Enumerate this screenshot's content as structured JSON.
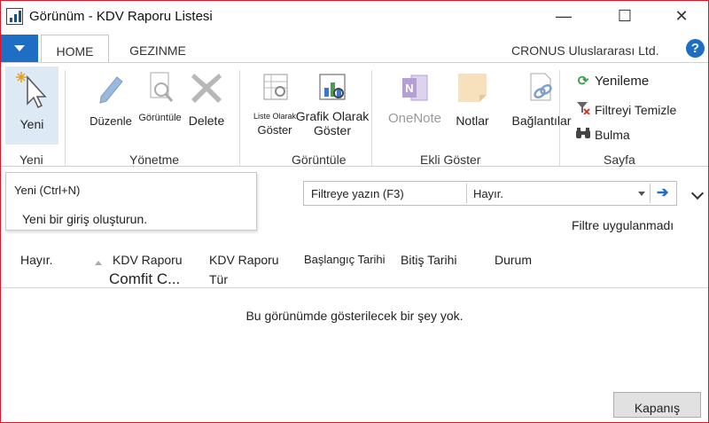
{
  "window": {
    "title": "Görünüm - KDV Raporu Listesi",
    "minimize": "—",
    "maximize": "☐",
    "close": "✕"
  },
  "tabs": [
    {
      "label": "HOME",
      "active": true
    },
    {
      "label": "GEZINME",
      "active": false
    }
  ],
  "company": "CRONUS Uluslararası Ltd.",
  "help_label": "?",
  "ribbon": {
    "yeni": {
      "label": "Yeni",
      "group": "Yeni"
    },
    "yonetme": {
      "group": "Yönetme",
      "duzenle": "Düzenle",
      "goruntule": "Görüntüle",
      "delete": "Delete"
    },
    "goruntule_group": {
      "group": "Görüntüle",
      "liste_line1": "Liste Olarak",
      "liste_line2": "Göster",
      "grafik_line1": "Grafik Olarak",
      "grafik_line2": "Göster"
    },
    "ekli": {
      "group": "Ekli Göster",
      "onenote": "OneNote",
      "notlar": "Notlar",
      "baglantilar": "Bağlantılar"
    },
    "sayfa": {
      "group": "Sayfa",
      "yenileme": "Yenileme",
      "filtreyi_temizle": "Filtreyi Temizle",
      "bulma": "Bulma"
    }
  },
  "tooltip": {
    "title": "Yeni (Ctrl+N)",
    "description": "Yeni bir giriş oluşturun."
  },
  "filter": {
    "label": "Filtreye yazın (F3)",
    "field_value": "Hayır.",
    "status": "Filtre uygulanmadı"
  },
  "columns": {
    "hayir": "Hayır.",
    "kdv_raporu": "KDV Raporu",
    "kdv_raporu_sub": "Comfit C...",
    "kdv_raporu_tur_line1": "KDV Raporu",
    "kdv_raporu_tur_line2": "Tür",
    "baslangic": "Başlangıç Tarihi",
    "bitis": "Bitiş Tarihi",
    "durum": "Durum"
  },
  "empty_message": "Bu görünümde gösterilecek bir şey yok.",
  "close_button": "Kapanış",
  "colors": {
    "accent": "#1e6fc4",
    "border_active": "#e81123",
    "onenote": "#b4a0d4",
    "notes": "#f5deb3"
  }
}
